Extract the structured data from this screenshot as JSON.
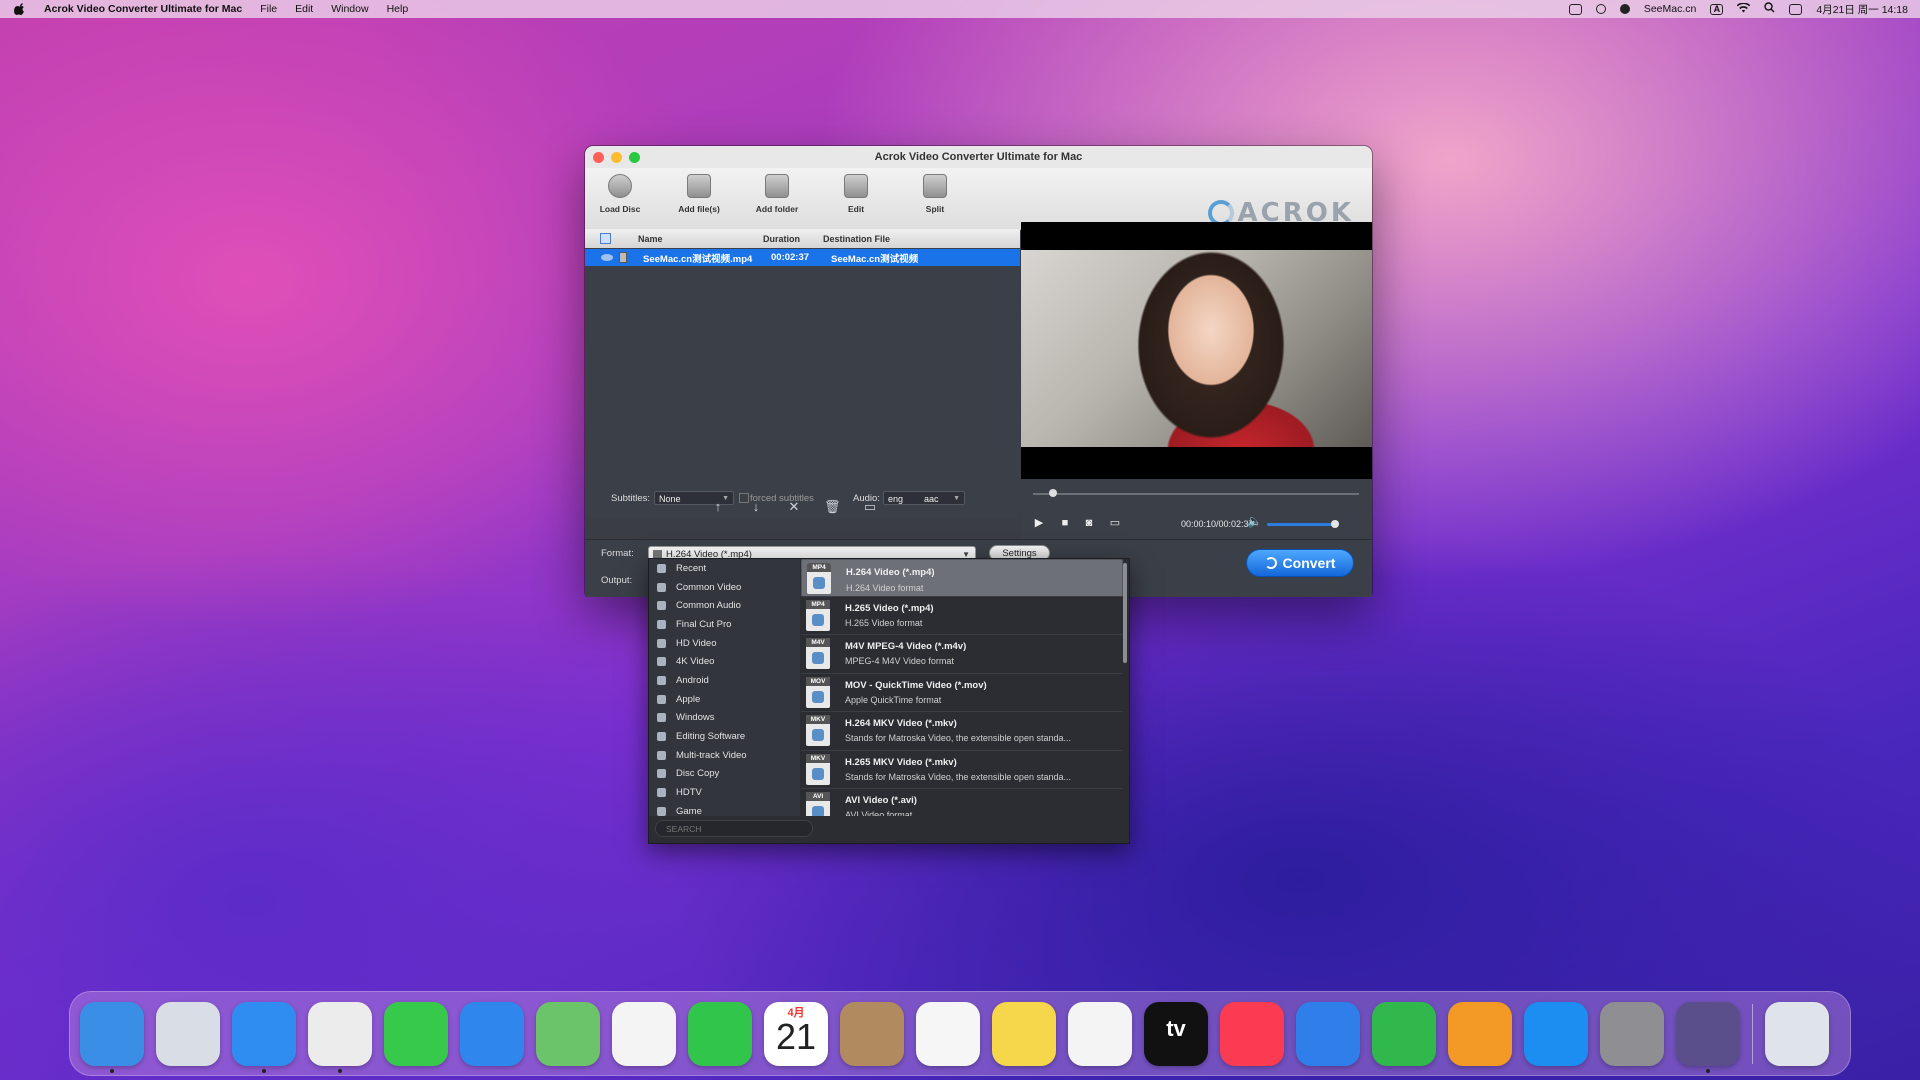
{
  "menubar": {
    "app_name": "Acrok Video Converter Ultimate for Mac",
    "menus": [
      "File",
      "Edit",
      "Window",
      "Help"
    ],
    "right_text": "SeeMac.cn",
    "input_badge": "A",
    "datetime": "4月21日 周一  14:18"
  },
  "window": {
    "title": "Acrok Video Converter Ultimate for Mac",
    "toolbar": [
      {
        "label": "Load Disc",
        "icon": "disc-icon"
      },
      {
        "label": "Add file(s)",
        "icon": "film-add-icon"
      },
      {
        "label": "Add folder",
        "icon": "folder-icon"
      },
      {
        "label": "Edit",
        "icon": "edit-icon"
      },
      {
        "label": "Split",
        "icon": "split-icon"
      }
    ],
    "logo_text": "ACROK",
    "list": {
      "headers": {
        "name": "Name",
        "duration": "Duration",
        "destination": "Destination File"
      },
      "rows": [
        {
          "name": "SeeMac.cn测试视频.mp4",
          "duration": "00:02:37",
          "destination": "SeeMac.cn测试视频"
        }
      ]
    },
    "subtitles": {
      "label": "Subtitles:",
      "value": "None",
      "forced_label": "forced subtitles"
    },
    "audio": {
      "label": "Audio:",
      "lang": "eng",
      "codec": "aac"
    },
    "player": {
      "time": "00:00:10/00:02:37",
      "progress": 0.06,
      "volume": 0.98
    },
    "format": {
      "label": "Format:",
      "value": "H.264 Video (*.mp4)"
    },
    "output": {
      "label": "Output:"
    },
    "settings_label": "Settings",
    "convert_label": "Convert"
  },
  "dropdown": {
    "categories": [
      "Recent",
      "Common Video",
      "Common Audio",
      "Final Cut Pro",
      "HD Video",
      "4K Video",
      "Android",
      "Apple",
      "Windows",
      "Editing Software",
      "Multi-track Video",
      "Disc Copy",
      "HDTV",
      "Game"
    ],
    "formats": [
      {
        "tag": "MP4",
        "name": "H.264 Video (*.mp4)",
        "desc": "H.264 Video format"
      },
      {
        "tag": "MP4",
        "name": "H.265 Video (*.mp4)",
        "desc": "H.265 Video format"
      },
      {
        "tag": "M4V",
        "name": "M4V MPEG-4 Video (*.m4v)",
        "desc": "MPEG-4 M4V Video format"
      },
      {
        "tag": "MOV",
        "name": "MOV - QuickTime Video (*.mov)",
        "desc": "Apple QuickTime format"
      },
      {
        "tag": "MKV",
        "name": "H.264 MKV Video (*.mkv)",
        "desc": "Stands for Matroska Video, the extensible open standa..."
      },
      {
        "tag": "MKV",
        "name": "H.265 MKV Video (*.mkv)",
        "desc": "Stands for Matroska Video, the extensible open standa..."
      },
      {
        "tag": "AVI",
        "name": "AVI Video (*.avi)",
        "desc": "AVI Video format"
      }
    ],
    "search_placeholder": "SEARCH"
  },
  "dock": {
    "calendar_month": "4月",
    "calendar_day": "21",
    "tv_label": "tv",
    "apps": [
      {
        "icon": "finder-icon",
        "color": "#3a8ee6"
      },
      {
        "icon": "launchpad-icon",
        "color": "#d9dde5"
      },
      {
        "icon": "safari-icon",
        "color": "#2f8cf0"
      },
      {
        "icon": "chrome-icon",
        "color": "#ececec"
      },
      {
        "icon": "messages-icon",
        "color": "#37c94c"
      },
      {
        "icon": "mail-icon",
        "color": "#2f86ec"
      },
      {
        "icon": "maps-icon",
        "color": "#6cc46a"
      },
      {
        "icon": "photos-icon",
        "color": "#f4f4f4"
      },
      {
        "icon": "facetime-icon",
        "color": "#32c54b"
      },
      {
        "icon": "calendar-icon",
        "color": "#ffffff"
      },
      {
        "icon": "contacts-icon",
        "color": "#b28a60"
      },
      {
        "icon": "reminders-icon",
        "color": "#f6f6f6"
      },
      {
        "icon": "notes-icon",
        "color": "#f6d64a"
      },
      {
        "icon": "freeform-icon",
        "color": "#f4f4f4"
      },
      {
        "icon": "appletv-icon",
        "color": "#111111"
      },
      {
        "icon": "music-icon",
        "color": "#fa3b52"
      },
      {
        "icon": "keynote-icon",
        "color": "#2f7ee9"
      },
      {
        "icon": "numbers-icon",
        "color": "#31b84c"
      },
      {
        "icon": "pages-icon",
        "color": "#f29a25"
      },
      {
        "icon": "appstore-icon",
        "color": "#1c8ef2"
      },
      {
        "icon": "system-settings-icon",
        "color": "#8e8e93"
      },
      {
        "icon": "acrok-converter-icon",
        "color": "#5a4f8a"
      },
      {
        "icon": "trash-icon",
        "color": "#dfe3ea"
      }
    ]
  }
}
